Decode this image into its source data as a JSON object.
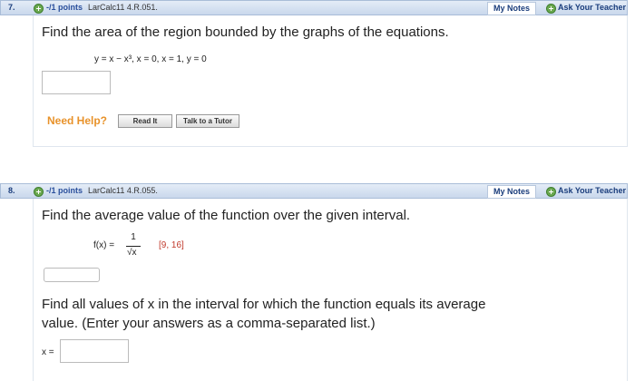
{
  "q7": {
    "number": "7.",
    "points": "-/1 points",
    "source": "LarCalc11 4.R.051.",
    "my_notes": "My Notes",
    "ask_teacher": "Ask Your Teacher",
    "prompt": "Find the area of the region bounded by the graphs of the equations.",
    "equation": "y = x − x³, x = 0, x = 1, y = 0",
    "answer_value": "",
    "need_help": "Need Help?",
    "read_it": "Read It",
    "talk_tutor": "Talk to a Tutor"
  },
  "q8": {
    "number": "8.",
    "points": "-/1 points",
    "source": "LarCalc11 4.R.055.",
    "my_notes": "My Notes",
    "ask_teacher": "Ask Your Teacher",
    "prompt": "Find the average value of the function over the given interval.",
    "function_lhs": "f(x) =",
    "numerator": "1",
    "denominator": "√x",
    "interval": "[9, 16]",
    "answer1_value": "",
    "prompt2_line1": "Find all values of x in the interval for which the function equals its average",
    "prompt2_line2": "value. (Enter your answers as a comma-separated list.)",
    "x_label": "x =",
    "answer2_value": ""
  },
  "colors": {
    "header_bg": "#c9d8ec",
    "link_blue": "#1a3d7c",
    "help_orange": "#e8922a",
    "interval_red": "#c0392b"
  }
}
